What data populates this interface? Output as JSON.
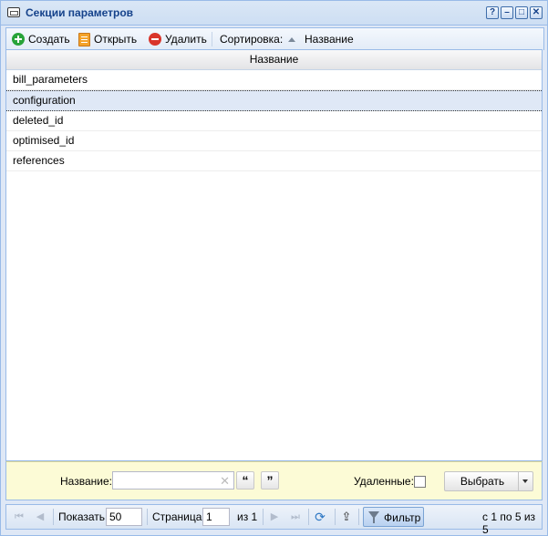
{
  "window": {
    "title": "Секции параметров",
    "controls": [
      "?",
      "–",
      "□",
      "✕"
    ]
  },
  "toolbar": {
    "create_label": "Создать",
    "open_label": "Открыть",
    "delete_label": "Удалить",
    "sort_label": "Сортировка:",
    "sort_field_label": "Название"
  },
  "grid": {
    "column_header": "Название",
    "rows": [
      "bill_parameters",
      "configuration",
      "deleted_id",
      "optimised_id",
      "references"
    ],
    "selected_row": "configuration"
  },
  "filter": {
    "name_label": "Название:",
    "name_value": "",
    "quote_open": "“",
    "quote_close": "”",
    "deleted_label": "Удаленные:",
    "deleted_checked": false,
    "select_label": "Выбрать"
  },
  "pager": {
    "show_label": "Показать",
    "page_size": "50",
    "page_label": "Страница",
    "page_value": "1",
    "of_label": "из 1",
    "filter_label": "Фильтр",
    "summary": "с 1 по 5 из 5"
  },
  "colors": {
    "accent": "#15428b",
    "border": "#99bbe8",
    "filter_bg": "#fcfbd6",
    "selected_row": "#dfe8f6"
  }
}
